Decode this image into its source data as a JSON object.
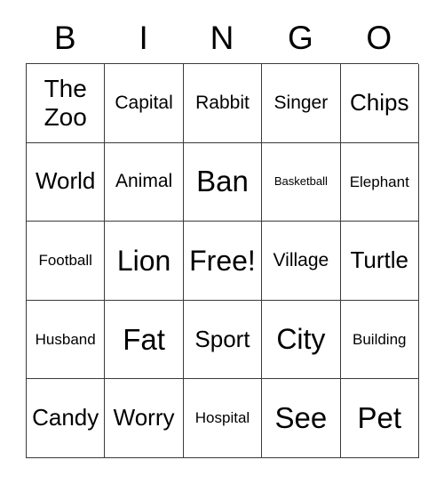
{
  "card": {
    "title": "BINGO",
    "headers": [
      "B",
      "I",
      "N",
      "G",
      "O"
    ],
    "free_space": "Free!",
    "grid_size": 5,
    "colors": {
      "background": "#ffffff",
      "text": "#000000",
      "border": "#3a3a3a"
    },
    "rows": [
      [
        {
          "label": "The\nZoo",
          "size": "ml"
        },
        {
          "label": "Capital",
          "size": "sm"
        },
        {
          "label": "Rabbit",
          "size": "sm"
        },
        {
          "label": "Singer",
          "size": "sm"
        },
        {
          "label": "Chips",
          "size": "md"
        }
      ],
      [
        {
          "label": "World",
          "size": "md"
        },
        {
          "label": "Animal",
          "size": "sm"
        },
        {
          "label": "Ban",
          "size": "xl"
        },
        {
          "label": "Basketball",
          "size": "xxs"
        },
        {
          "label": "Elephant",
          "size": "xs"
        }
      ],
      [
        {
          "label": "Football",
          "size": "xs"
        },
        {
          "label": "Lion",
          "size": "lg"
        },
        {
          "label": "Free!",
          "size": "lg"
        },
        {
          "label": "Village",
          "size": "sm"
        },
        {
          "label": "Turtle",
          "size": "md"
        }
      ],
      [
        {
          "label": "Husband",
          "size": "xs"
        },
        {
          "label": "Fat",
          "size": "xl"
        },
        {
          "label": "Sport",
          "size": "md"
        },
        {
          "label": "City",
          "size": "lg"
        },
        {
          "label": "Building",
          "size": "xs"
        }
      ],
      [
        {
          "label": "Candy",
          "size": "md"
        },
        {
          "label": "Worry",
          "size": "md"
        },
        {
          "label": "Hospital",
          "size": "xs"
        },
        {
          "label": "See",
          "size": "xl"
        },
        {
          "label": "Pet",
          "size": "xl"
        }
      ]
    ]
  }
}
